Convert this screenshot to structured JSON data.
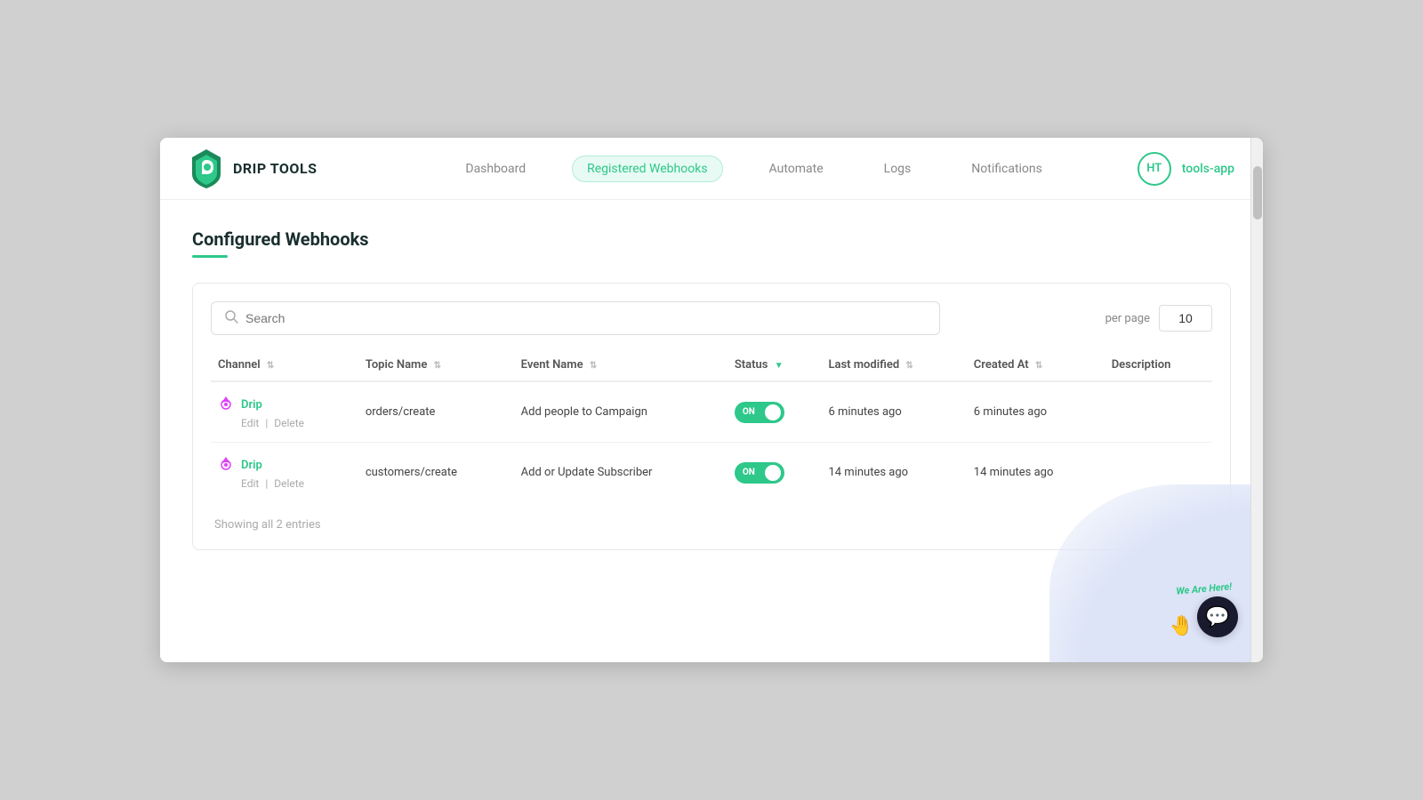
{
  "app": {
    "logo_text": "DRIP TOOLS",
    "username": "tools-app",
    "avatar_initials": "HT"
  },
  "nav": {
    "items": [
      {
        "id": "dashboard",
        "label": "Dashboard",
        "active": false
      },
      {
        "id": "registered-webhooks",
        "label": "Registered Webhooks",
        "active": true
      },
      {
        "id": "automate",
        "label": "Automate",
        "active": false
      },
      {
        "id": "logs",
        "label": "Logs",
        "active": false
      },
      {
        "id": "notifications",
        "label": "Notifications",
        "active": false
      }
    ]
  },
  "page": {
    "title": "Configured Webhooks"
  },
  "toolbar": {
    "search_placeholder": "Search",
    "per_page_label": "per page",
    "per_page_value": "10"
  },
  "table": {
    "columns": [
      {
        "id": "channel",
        "label": "Channel"
      },
      {
        "id": "topic_name",
        "label": "Topic Name"
      },
      {
        "id": "event_name",
        "label": "Event Name"
      },
      {
        "id": "status",
        "label": "Status"
      },
      {
        "id": "last_modified",
        "label": "Last modified"
      },
      {
        "id": "created_at",
        "label": "Created At"
      },
      {
        "id": "description",
        "label": "Description"
      }
    ],
    "rows": [
      {
        "channel_name": "Drip",
        "edit_label": "Edit",
        "delete_label": "Delete",
        "topic_name": "orders/create",
        "event_name": "Add people to Campaign",
        "status": "ON",
        "status_on": true,
        "last_modified": "6 minutes ago",
        "created_at": "6 minutes ago",
        "description": ""
      },
      {
        "channel_name": "Drip",
        "edit_label": "Edit",
        "delete_label": "Delete",
        "topic_name": "customers/create",
        "event_name": "Add or Update Subscriber",
        "status": "ON",
        "status_on": true,
        "last_modified": "14 minutes ago",
        "created_at": "14 minutes ago",
        "description": ""
      }
    ]
  },
  "footer": {
    "showing_text": "Showing all 2 entries"
  },
  "chat": {
    "we_are_here": "We Are Here!",
    "emoji": "🤚",
    "icon": "💬"
  }
}
